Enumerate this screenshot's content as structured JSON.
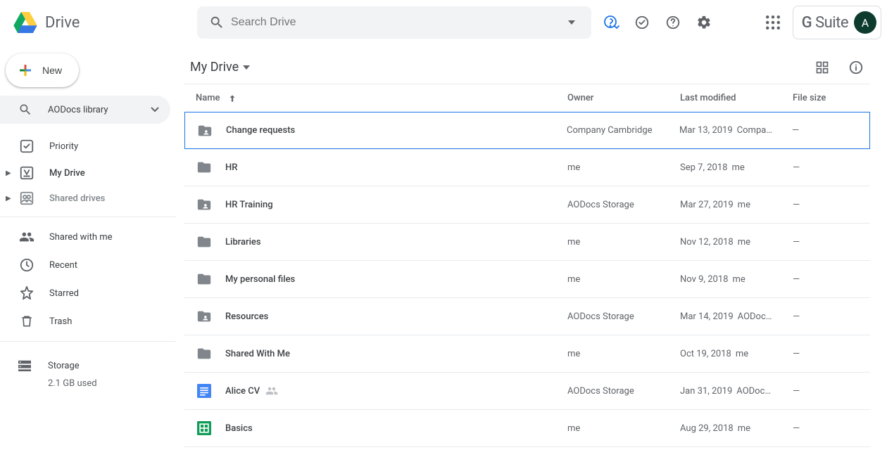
{
  "header": {
    "app_name": "Drive",
    "search_placeholder": "Search Drive",
    "gsuite_label": "G Suite",
    "avatar_initial": "A"
  },
  "sidebar": {
    "new_label": "New",
    "library_search": "AODocs library",
    "priority": "Priority",
    "my_drive": "My Drive",
    "shared_drives": "Shared drives",
    "shared_with_me": "Shared with me",
    "recent": "Recent",
    "starred": "Starred",
    "trash": "Trash",
    "storage_label": "Storage",
    "storage_used": "2.1 GB used"
  },
  "main": {
    "breadcrumb": "My Drive",
    "columns": {
      "name": "Name",
      "owner": "Owner",
      "modified": "Last modified",
      "size": "File size"
    },
    "rows": [
      {
        "type": "folder-shared",
        "name": "Change requests",
        "owner": "Company Cambridge",
        "modified": "Mar 13, 2019",
        "modified_by": "Compa…",
        "size": "—",
        "selected": true
      },
      {
        "type": "folder",
        "name": "HR",
        "owner": "me",
        "modified": "Sep 7, 2018",
        "modified_by": "me",
        "size": "—"
      },
      {
        "type": "folder-shared",
        "name": "HR Training",
        "owner": "AODocs Storage",
        "modified": "Mar 27, 2019",
        "modified_by": "me",
        "size": "—"
      },
      {
        "type": "folder",
        "name": "Libraries",
        "owner": "me",
        "modified": "Nov 12, 2018",
        "modified_by": "me",
        "size": "—"
      },
      {
        "type": "folder",
        "name": "My personal files",
        "owner": "me",
        "modified": "Nov 9, 2018",
        "modified_by": "me",
        "size": "—"
      },
      {
        "type": "folder-shared",
        "name": "Resources",
        "owner": "AODocs Storage",
        "modified": "Mar 14, 2019",
        "modified_by": "AODoc…",
        "size": "—"
      },
      {
        "type": "folder",
        "name": "Shared With Me",
        "owner": "me",
        "modified": "Oct 19, 2018",
        "modified_by": "me",
        "size": "—"
      },
      {
        "type": "doc",
        "name": "Alice CV",
        "shared": true,
        "owner": "AODocs Storage",
        "modified": "Jan 31, 2019",
        "modified_by": "AODoc…",
        "size": "—"
      },
      {
        "type": "sheet",
        "name": "Basics",
        "owner": "me",
        "modified": "Aug 29, 2018",
        "modified_by": "me",
        "size": "—"
      }
    ]
  }
}
